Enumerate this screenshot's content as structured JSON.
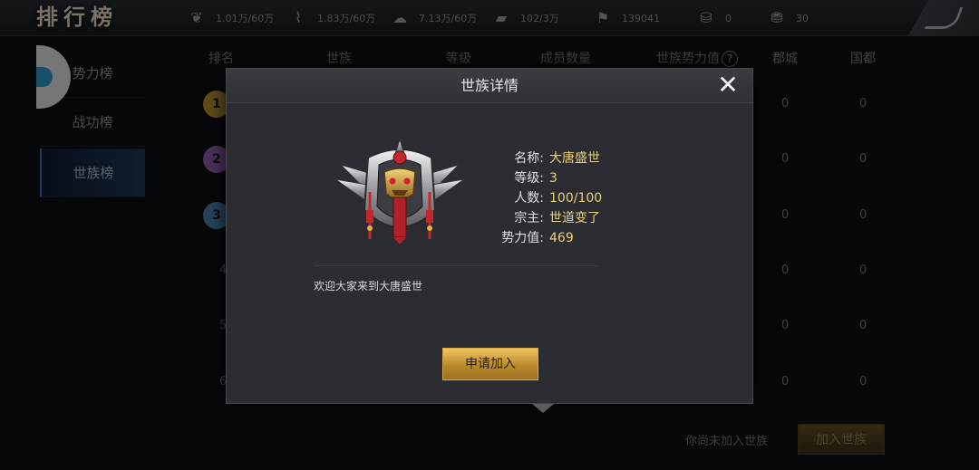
{
  "topbar": {
    "title": "排行榜",
    "resources": [
      {
        "icon": "feather-icon",
        "value": "1.01万/60万"
      },
      {
        "icon": "scroll-icon",
        "value": "1.83万/60万"
      },
      {
        "icon": "cloud-icon",
        "value": "7.13万/60万"
      },
      {
        "icon": "stone-icon",
        "value": "102/3万"
      },
      {
        "icon": "flag-icon",
        "value": "139041"
      },
      {
        "icon": "silver-ingot-icon",
        "value": "0"
      },
      {
        "icon": "gold-ingot-icon",
        "value": "30"
      }
    ]
  },
  "sidebar": {
    "items": [
      {
        "label": "势力榜"
      },
      {
        "label": "战功榜"
      },
      {
        "label": "世族榜"
      }
    ],
    "active": "世族榜"
  },
  "table": {
    "headers": {
      "rank": "排名",
      "clan": "世族",
      "level": "等级",
      "members": "成员数量",
      "power": "世族势力值",
      "county": "郡城",
      "capital": "国都"
    },
    "rows": [
      {
        "rank": "1",
        "county": "0",
        "capital": "0"
      },
      {
        "rank": "2",
        "county": "0",
        "capital": "0"
      },
      {
        "rank": "3",
        "county": "0",
        "capital": "0"
      },
      {
        "rank": "4",
        "county": "0",
        "capital": "0"
      },
      {
        "rank": "5",
        "county": "0",
        "capital": "0"
      },
      {
        "rank": "6",
        "county": "0",
        "capital": "0"
      }
    ]
  },
  "footer": {
    "status_text": "你尚未加入世族",
    "join_label": "加入世族"
  },
  "modal": {
    "title": "世族详情",
    "close_icon": "close-icon",
    "info": [
      {
        "label": "名称:",
        "value": "大唐盛世"
      },
      {
        "label": "等级:",
        "value": "3"
      },
      {
        "label": "人数:",
        "value": "100/100"
      },
      {
        "label": "宗主:",
        "value": "世道变了"
      },
      {
        "label": "势力值:",
        "value": "469"
      }
    ],
    "motto": "欢迎大家来到大唐盛世",
    "apply_label": "申请加入"
  },
  "colors": {
    "accent_gold": "#e8d07a",
    "button_gold": "#d8aa48",
    "active_tab": "#1c3556"
  }
}
